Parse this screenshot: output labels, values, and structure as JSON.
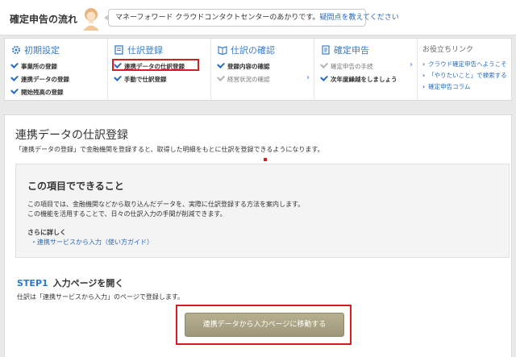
{
  "header": {
    "title": "確定申告の流れ",
    "speech_text": "マネーフォワード クラウドコンタクトセンターのあかりです。",
    "speech_link": "疑問点を教えてください"
  },
  "steps": {
    "initial": {
      "title": "初期設定",
      "items": [
        "事業所の登録",
        "連携データの登録",
        "開始残高の登録"
      ]
    },
    "journal": {
      "title": "仕訳登録",
      "items": [
        "連携データの仕訳登録",
        "手動で仕訳登録"
      ]
    },
    "check": {
      "title": "仕訳の確認",
      "items": [
        "登録内容の確認",
        "経営状況の確認"
      ]
    },
    "filing": {
      "title": "確定申告",
      "items": [
        "確定申告の手続",
        "次年度繰越をしましょう"
      ]
    },
    "help": {
      "title": "お役立ちリンク",
      "links": [
        "クラウド確定申告へようこそ",
        "「やりたいこと」で検索する",
        "確定申告コラム"
      ]
    }
  },
  "main": {
    "title": "連携データの仕訳登録",
    "description": "「連携データの登録」で金融機関を登録すると、取得した明細をもとに仕訳を登録できるようになります。",
    "info": {
      "title": "この項目でできること",
      "line1": "この項目では、金融機関などから取り込んだデータを、実際に仕訳登録する方法を案内します。",
      "line2": "この機能を活用することで、日々の仕訳入力の手間が削減できます。",
      "more_title": "さらに詳しく",
      "more_link": "・連携サービスから入力（使い方ガイド）"
    },
    "step1": {
      "label": "STEP1",
      "title": "入力ページを開く",
      "description": "仕訳は「連携サービスから入力」のページで登録します。",
      "button": "連携データから入力ページに移動する"
    }
  },
  "colors": {
    "accent": "#3b7cc9",
    "highlight": "#d42020",
    "button": "#a8a184"
  }
}
